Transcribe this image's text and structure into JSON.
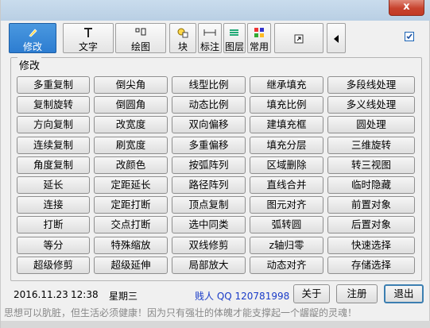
{
  "window": {
    "close_label": "x"
  },
  "toolbar": {
    "items": [
      {
        "label": "修改",
        "icon": "pencil-icon"
      },
      {
        "label": "文字",
        "icon": "text-T-icon"
      },
      {
        "label": "绘图",
        "icon": "draw-icon"
      },
      {
        "label": "块",
        "icon": "block-icon"
      },
      {
        "label": "标注",
        "icon": "dimension-icon"
      },
      {
        "label": "图层",
        "icon": "layers-icon"
      },
      {
        "label": "常用",
        "icon": "grid-icon"
      }
    ],
    "extra_icons": [
      "arrow-link-icon",
      "left-triangle-icon",
      "checkbox-icon"
    ]
  },
  "group": {
    "title": "修改",
    "rows": [
      [
        "多重复制",
        "倒尖角",
        "线型比例",
        "继承填充",
        "多段线处理"
      ],
      [
        "复制旋转",
        "倒圆角",
        "动态比例",
        "填充比例",
        "多义线处理"
      ],
      [
        "方向复制",
        "改宽度",
        "双向偏移",
        "建填充框",
        "圆处理"
      ],
      [
        "连续复制",
        "刷宽度",
        "多重偏移",
        "填充分层",
        "三维旋转"
      ],
      [
        "角度复制",
        "改颜色",
        "按弧阵列",
        "区域删除",
        "转三视图"
      ],
      [
        "延长",
        "定距延长",
        "路径阵列",
        "直线合并",
        "临时隐藏"
      ],
      [
        "连接",
        "定距打断",
        "顶点复制",
        "图元对齐",
        "前置对象"
      ],
      [
        "打断",
        "交点打断",
        "选中同类",
        "弧转圆",
        "后置对象"
      ],
      [
        "等分",
        "特殊缩放",
        "双线修剪",
        "z轴归零",
        "快速选择"
      ],
      [
        "超级修剪",
        "超级延伸",
        "局部放大",
        "动态对齐",
        "存储选择"
      ]
    ]
  },
  "status": {
    "date": "2016.11.23",
    "time": "12:38",
    "weekday": "星期三",
    "author": "贱人 QQ 120781998"
  },
  "buttons": {
    "about": "关于",
    "register": "注册",
    "exit": "退出"
  },
  "slogan": "思想可以肮脏，但生活必须健康！因为只有强壮的体魄才能支撑起一个龌龊的灵魂！",
  "colors": {
    "accent": "#2d7dd1",
    "author_link": "#1a3cc8",
    "close": "#c7432e"
  }
}
